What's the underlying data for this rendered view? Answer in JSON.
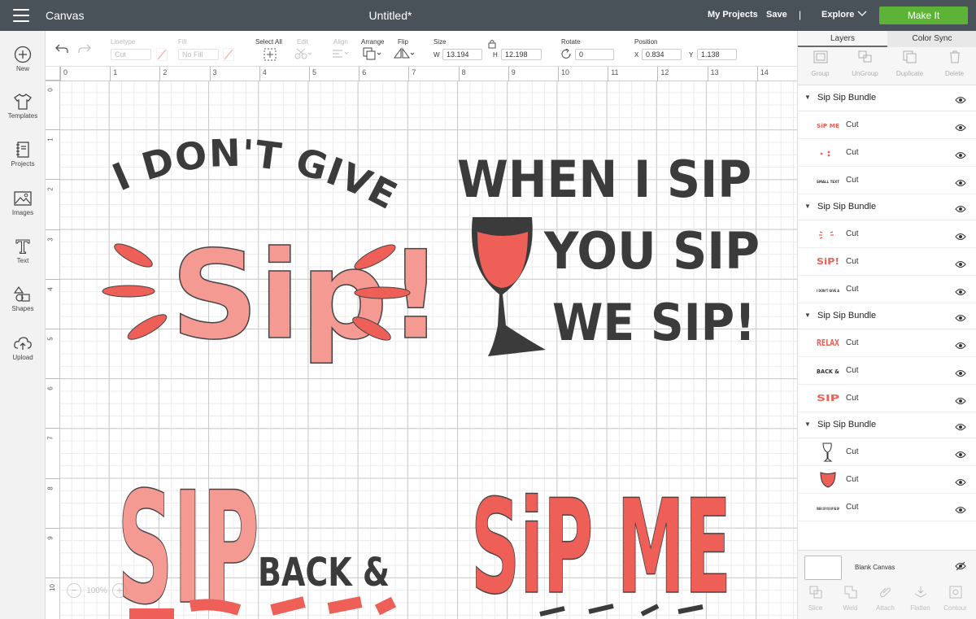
{
  "topbar": {
    "app_name": "Canvas",
    "doc_title": "Untitled*",
    "my_projects": "My Projects",
    "save": "Save",
    "separator": "|",
    "explore": "Explore",
    "make_it": "Make It",
    "make_it_color": "#5cb335",
    "bar_color": "#4a5259"
  },
  "leftbar": {
    "items": [
      {
        "label": "New",
        "icon": "plus-circle-icon"
      },
      {
        "label": "Templates",
        "icon": "tshirt-icon"
      },
      {
        "label": "Projects",
        "icon": "notebook-icon"
      },
      {
        "label": "Images",
        "icon": "image-icon"
      },
      {
        "label": "Text",
        "icon": "text-t-icon"
      },
      {
        "label": "Shapes",
        "icon": "shapes-icon"
      },
      {
        "label": "Upload",
        "icon": "cloud-upload-icon"
      }
    ]
  },
  "toolbar": {
    "linetype_label": "Linetype",
    "linetype_value": "Cut",
    "fill_label": "Fill",
    "fill_value": "No Fill",
    "select_all": "Select All",
    "edit": "Edit",
    "align": "Align",
    "arrange": "Arrange",
    "flip": "Flip",
    "size_label": "Size",
    "w_label": "W",
    "w_value": "13.194",
    "h_label": "H",
    "h_value": "12.198",
    "rotate_label": "Rotate",
    "rotate_value": "0",
    "position_label": "Position",
    "x_label": "X",
    "x_value": "0.834",
    "y_label": "Y",
    "y_value": "1.138"
  },
  "ruler": {
    "top": [
      "0",
      "1",
      "2",
      "3",
      "4",
      "5",
      "6",
      "7",
      "8",
      "9",
      "10",
      "11",
      "12",
      "13",
      "14"
    ],
    "left": [
      "0",
      "1",
      "2",
      "3",
      "4",
      "5",
      "6",
      "7",
      "8",
      "9",
      "10"
    ]
  },
  "zoom": {
    "minus": "−",
    "value": "100%",
    "plus": "+"
  },
  "artwork": {
    "design1": {
      "arc_text": "I DON'T GIVE A",
      "big_text": "Sip!"
    },
    "design2": {
      "line1": "WHEN I SIP",
      "line2": "YOU SIP",
      "line3": "WE SIP!"
    },
    "design3": {
      "big_text": "SIP",
      "small_text": "BACK &"
    },
    "design4": {
      "big_text": "SiP ME"
    },
    "colors": {
      "coral": "#ee5f58",
      "pink": "#f49a93",
      "dark": "#3b3b3b"
    }
  },
  "panel": {
    "tabs": [
      "Layers",
      "Color Sync"
    ],
    "tools": [
      "Group",
      "UnGroup",
      "Duplicate",
      "Delete"
    ],
    "groups": [
      {
        "name": "Sip Sip Bundle",
        "items": [
          {
            "label": "Cut",
            "thumb": "SiP ME"
          },
          {
            "label": "Cut",
            "thumb": "dots"
          },
          {
            "label": "Cut",
            "thumb": "SMALL TEXT"
          }
        ]
      },
      {
        "name": "Sip Sip Bundle",
        "items": [
          {
            "label": "Cut",
            "thumb": "dashes"
          },
          {
            "label": "Cut",
            "thumb": "SiP!"
          },
          {
            "label": "Cut",
            "thumb": "I DON'T GIVE A"
          }
        ]
      },
      {
        "name": "Sip Sip Bundle",
        "items": [
          {
            "label": "Cut",
            "thumb": "RELAX"
          },
          {
            "label": "Cut",
            "thumb": "BACK &"
          },
          {
            "label": "Cut",
            "thumb": "SIP"
          }
        ]
      },
      {
        "name": "Sip Sip Bundle",
        "items": [
          {
            "label": "Cut",
            "thumb": "glass"
          },
          {
            "label": "Cut",
            "thumb": "wine"
          },
          {
            "label": "Cut",
            "thumb": "WHEN I SIP YOU SIP WE SIP"
          }
        ]
      }
    ],
    "blank_canvas": "Blank Canvas",
    "bottom_tools": [
      "Slice",
      "Weld",
      "Attach",
      "Flatten",
      "Contour"
    ]
  }
}
